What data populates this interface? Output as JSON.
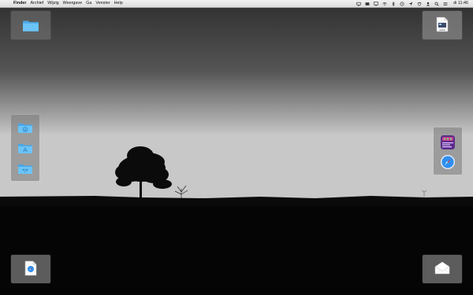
{
  "menubar": {
    "apple_glyph": "",
    "items": [
      "Finder",
      "Archief",
      "Wijzig",
      "Weergave",
      "Ga",
      "Venster",
      "Help"
    ],
    "clock": "di 11:46",
    "status_icons": [
      "screen-mirroring-icon",
      "display-icon",
      "cast-icon",
      "wifi-icon",
      "bluetooth-icon",
      "time-machine-icon",
      "location-icon",
      "battery-icon",
      "user-icon",
      "spotlight-icon",
      "notification-center-icon"
    ]
  },
  "corners": {
    "top_left": {
      "icon": "folder-icon"
    },
    "top_right": {
      "icon": "document-preview-icon"
    },
    "bottom_left": {
      "icon": "safari-document-icon"
    },
    "bottom_right": {
      "icon": "mail-envelope-icon"
    }
  },
  "left_stack": {
    "icons": [
      "downloads-folder-icon",
      "applications-folder-icon",
      "dropbox-folder-icon"
    ]
  },
  "right_stack": {
    "icons": [
      "app-window-icon",
      "safari-icon"
    ]
  },
  "colors": {
    "folder_blue": "#6cc3f5",
    "folder_blue_dark": "#4aa7e6",
    "panel": "#7a7a7a"
  }
}
